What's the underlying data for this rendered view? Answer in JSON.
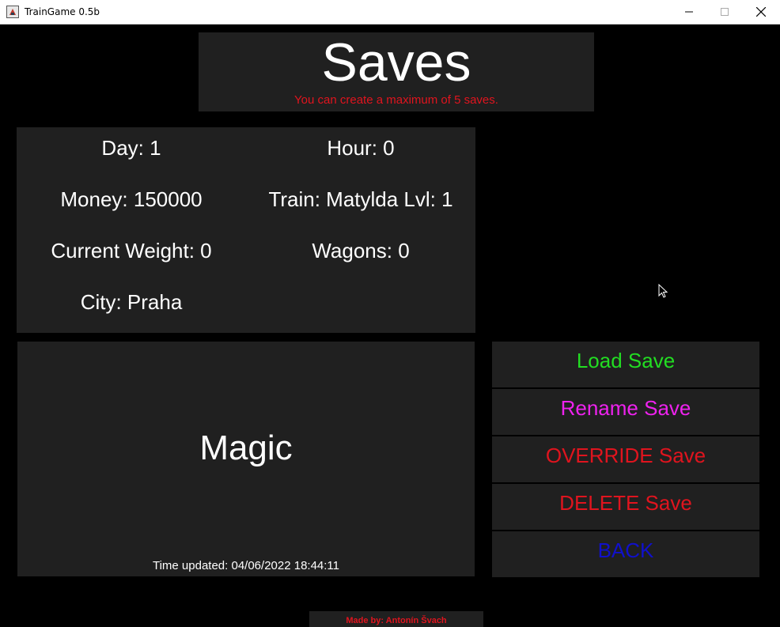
{
  "window": {
    "title": "TrainGame 0.5b",
    "icon": "java-app-icon"
  },
  "header": {
    "title": "Saves",
    "subtitle": "You can create a maximum of 5 saves."
  },
  "info": {
    "day": "Day: 1",
    "hour": "Hour: 0",
    "money": "Money: 150000",
    "train": "Train: Matylda Lvl: 1",
    "current_weight": "Current Weight: 0",
    "wagons": "Wagons: 0",
    "city": "City: Praha"
  },
  "save": {
    "name": "Magic",
    "time_updated": "Time updated: 04/06/2022 18:44:11"
  },
  "actions": {
    "load": "Load Save",
    "rename": "Rename Save",
    "override": "OVERRIDE Save",
    "delete": "DELETE Save",
    "back": "BACK"
  },
  "footer": {
    "credit": "Made by: Antonín Švach"
  },
  "colors": {
    "background": "#000000",
    "panel": "#202020",
    "text": "#ffffff",
    "red": "#e0141e",
    "green": "#22dd22",
    "magenta": "#ee22ee",
    "blue": "#1010cc"
  }
}
